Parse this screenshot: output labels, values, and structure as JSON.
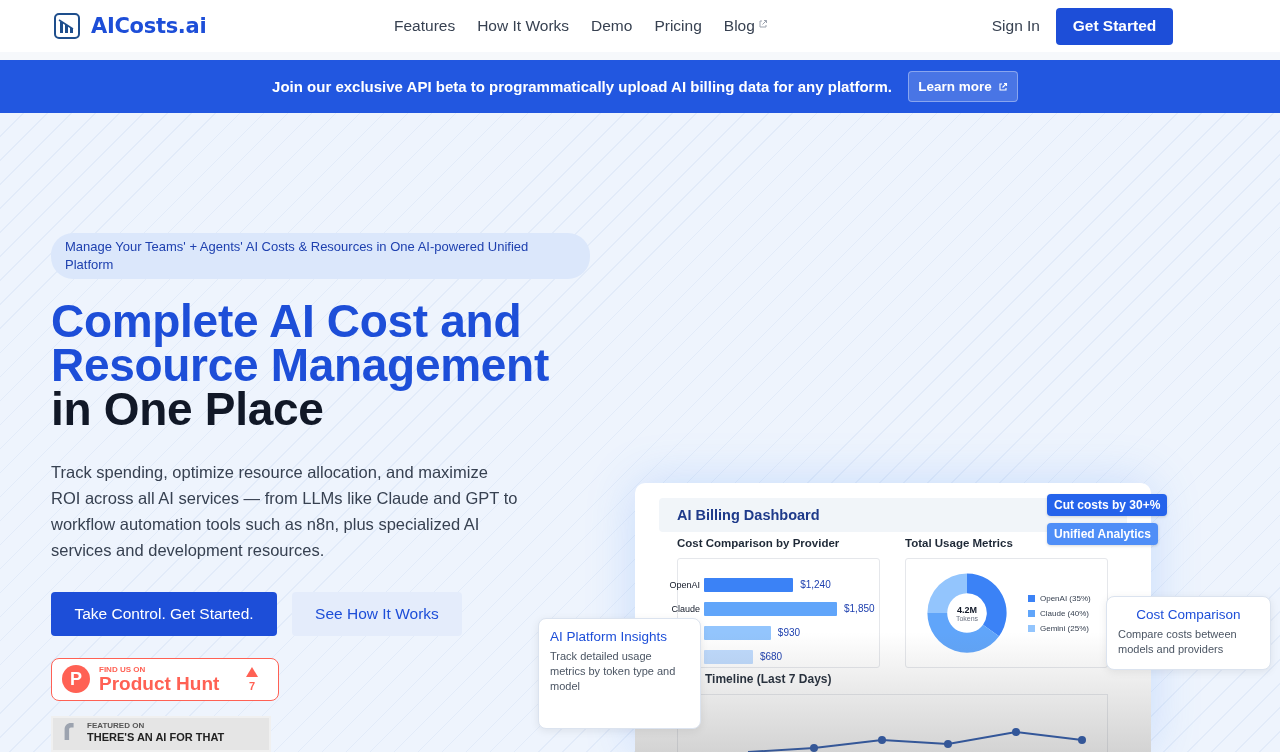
{
  "header": {
    "brand": "AICosts.ai",
    "nav": [
      {
        "label": "Features",
        "external": false
      },
      {
        "label": "How It Works",
        "external": false
      },
      {
        "label": "Demo",
        "external": false
      },
      {
        "label": "Pricing",
        "external": false
      },
      {
        "label": "Blog",
        "external": true
      }
    ],
    "sign_in": "Sign In",
    "cta": "Get Started"
  },
  "banner": {
    "text": "Join our exclusive API beta to programmatically upload AI billing data for any platform.",
    "button": "Learn more"
  },
  "hero": {
    "tagline": "Manage Your Teams' + Agents' AI Costs & Resources in One AI-powered Unified Platform",
    "title": [
      {
        "text": "Complete AI Cost and Resource Management",
        "accent": true
      },
      {
        "text": "in One Place",
        "accent": false
      }
    ],
    "description": "Track spending, optimize resource allocation, and maximize ROI across all AI services — from LLMs like Claude and GPT to workflow automation tools such as n8n, plus specialized AI services and development resources.",
    "primary_button": "Take Control. Get Started.",
    "secondary_button": "See How It Works",
    "product_hunt": {
      "logo_letter": "P",
      "eyebrow": "FIND US ON",
      "name": "Product Hunt",
      "votes": "7"
    },
    "featured_badge": {
      "eyebrow": "FEATURED ON",
      "name": "THERE'S AN AI FOR THAT"
    }
  },
  "dashboard": {
    "title": "AI Billing Dashboard",
    "badges": [
      {
        "text": "Cut costs by 30+%",
        "kind": "primary"
      },
      {
        "text": "Unified Analytics",
        "kind": "secondary"
      }
    ],
    "bar_panel": {
      "title": "Cost Comparison by Provider",
      "bars": [
        {
          "label": "OpenAI",
          "amount": "$1,240",
          "color": "#3b82f6"
        },
        {
          "label": "Claude",
          "amount": "$1,850",
          "color": "#60a5fa"
        },
        {
          "amount": "$930",
          "color": "#93c5fd"
        },
        {
          "amount": "$680",
          "color": "#bfdbfe"
        }
      ]
    },
    "usage_panel": {
      "title": "Total Usage Metrics",
      "center_value": "4.2M",
      "chart_data": {
        "type": "donut",
        "categories": [
          "OpenAI (35%)",
          "Claude (40%)",
          "Gemini (25%)"
        ],
        "series": [
          {
            "name": "Tokens",
            "values": [
              35,
              40,
              25
            ]
          }
        ]
      },
      "slices": [
        {
          "color": "#3b82f6"
        },
        {
          "color": "#60a5fa"
        },
        {
          "color": "#93c5fd"
        }
      ]
    },
    "timeline_title": "Timeline (Last 7 Days)"
  },
  "floating_cards": [
    {
      "title": "AI Platform Insights",
      "text": "Track detailed usage metrics by token type and model"
    },
    {
      "title": "Cost Comparison",
      "text": "Compare costs between models and providers"
    }
  ]
}
